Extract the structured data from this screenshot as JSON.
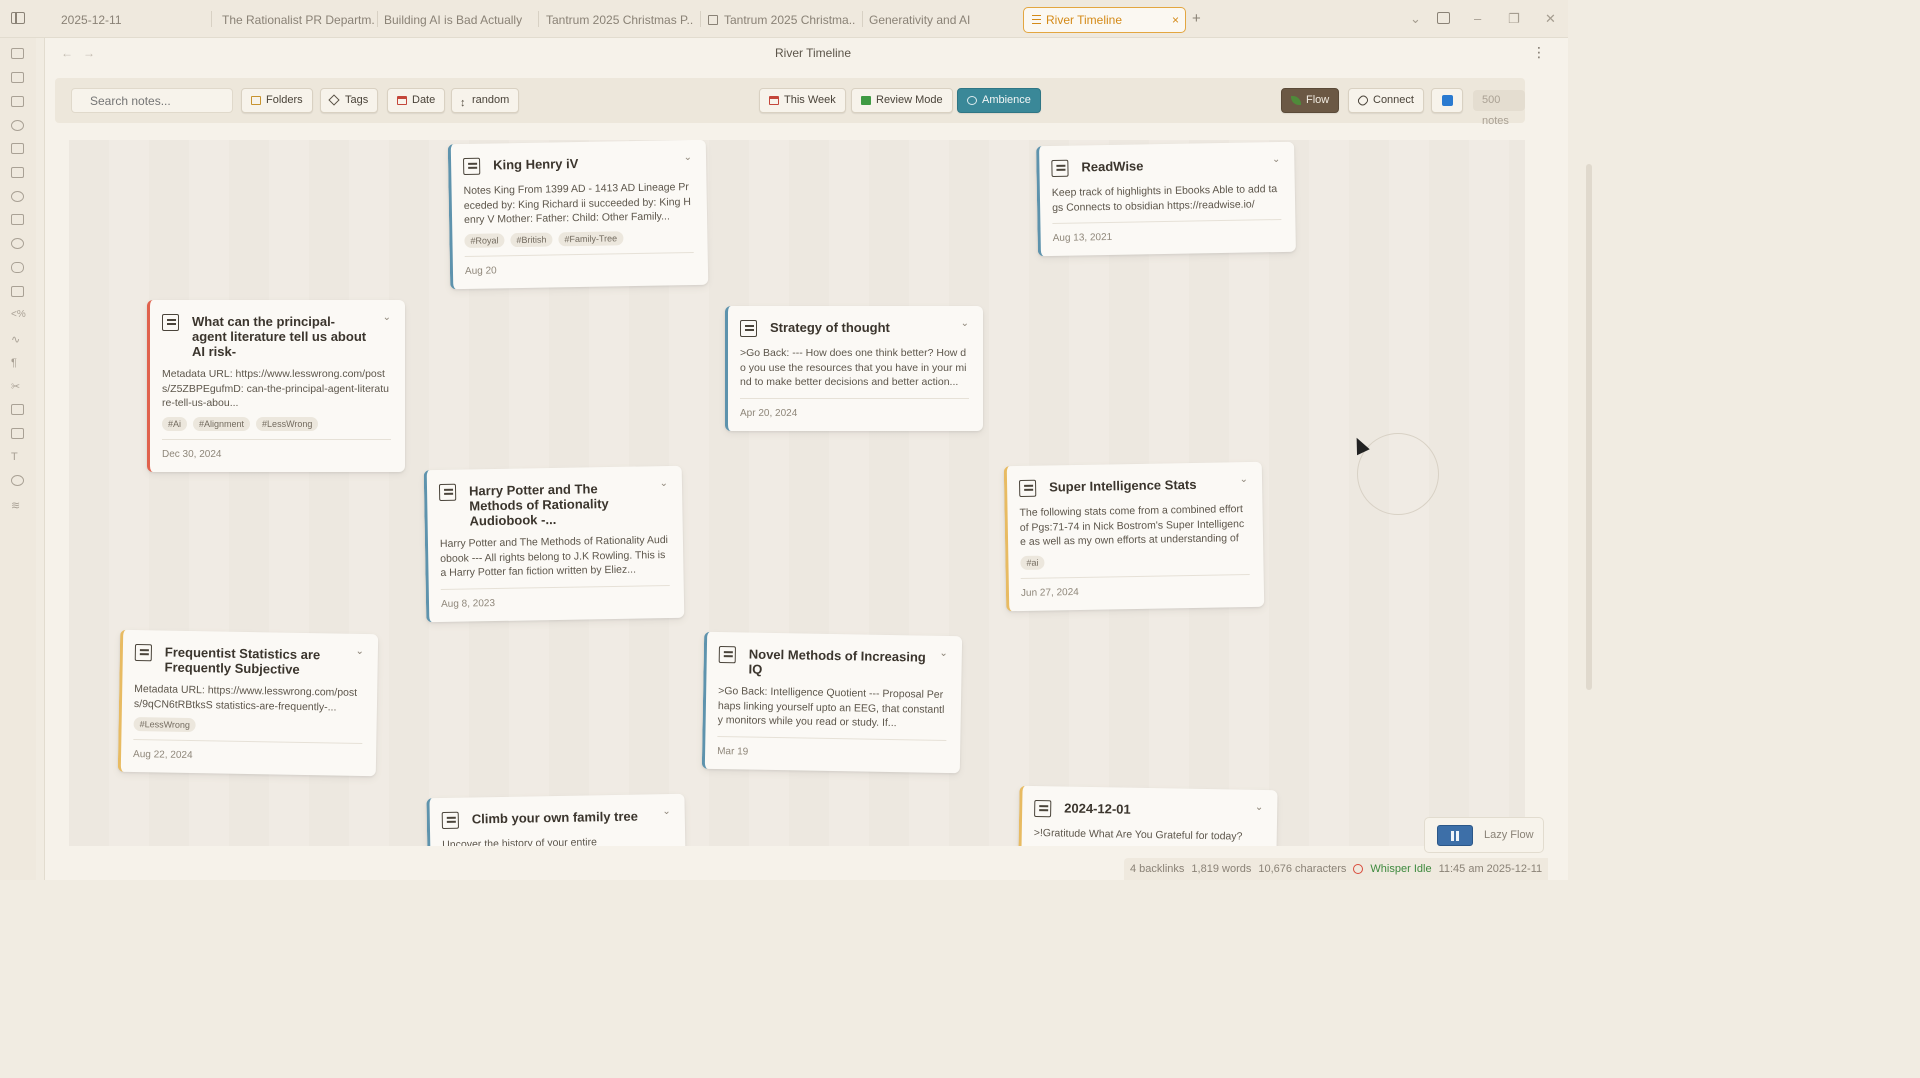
{
  "tabs": [
    {
      "label": "2025-12-11"
    },
    {
      "label": "The Rationalist PR Departm..."
    },
    {
      "label": "Building AI is Bad Actually"
    },
    {
      "label": "Tantrum 2025 Christmas P..."
    },
    {
      "label": "Tantrum 2025 Christma..."
    },
    {
      "label": "Generativity and AI"
    },
    {
      "label": "River Timeline"
    }
  ],
  "tab_close": "×",
  "tab_add": "+",
  "pane_title": "River Timeline",
  "toolbar": {
    "search_placeholder": "Search notes...",
    "folders": "Folders",
    "tags": "Tags",
    "date": "Date",
    "random": "random",
    "this_week": "This Week",
    "review_mode": "Review Mode",
    "ambience": "Ambience",
    "flow": "Flow",
    "connect": "Connect",
    "notes_count": "500 notes"
  },
  "cards": [
    {
      "title": "King Henry iV",
      "body": "Notes King From 1399 AD - 1413 AD Lineage Preceded by: King Richard ii succeeded by: King Henry V Mother: Father: Child: Other Family...",
      "tags": [
        "#Royal",
        "#British",
        "#Family-Tree"
      ],
      "date": "Aug 20"
    },
    {
      "title": "ReadWise",
      "body": "Keep track of highlights in Ebooks Able to add tags Connects to obsidian https://readwise.io/",
      "tags": [],
      "date": "Aug 13, 2021"
    },
    {
      "title": "What can the principal-agent literature tell us about AI risk-",
      "body": "Metadata URL: https://www.lesswrong.com/posts/Z5ZBPEgufmD: can-the-principal-agent-literature-tell-us-abou...",
      "tags": [
        "#Ai",
        "#Alignment",
        "#LessWrong"
      ],
      "date": "Dec 30, 2024"
    },
    {
      "title": "Strategy of thought",
      "body": ">Go Back: --- How does one think better? How do you use the resources that you have in your mind to make better decisions and better action...",
      "tags": [],
      "date": "Apr 20, 2024"
    },
    {
      "title": "Harry Potter and The Methods of Rationality Audiobook -...",
      "body": "Harry Potter and The Methods of Rationality Audiobook --- All rights belong to J.K Rowling. This is a Harry Potter fan fiction written by Eliez...",
      "tags": [],
      "date": "Aug 8, 2023"
    },
    {
      "title": "Super Intelligence Stats",
      "body": "The following stats come from a combined effort of Pgs:71-74 in Nick Bostrom's Super Intelligence as well as my own efforts at understanding of t...",
      "tags": [
        "#ai"
      ],
      "date": "Jun 27, 2024"
    },
    {
      "title": "Frequentist Statistics are Frequently Subjective",
      "body": "Metadata URL: https://www.lesswrong.com/posts/9qCN6tRBtksS statistics-are-frequently-...",
      "tags": [
        "#LessWrong"
      ],
      "date": "Aug 22, 2024"
    },
    {
      "title": "Novel Methods of Increasing IQ",
      "body": ">Go Back: Intelligence Quotient --- Proposal Perhaps linking yourself upto an EEG, that constantly monitors while you read or study. If...",
      "tags": [],
      "date": "Mar 19"
    },
    {
      "title": "Climb your own family tree",
      "body": "Uncover the history of your entire",
      "tags": [],
      "date": ""
    },
    {
      "title": "2024-12-01",
      "body": ">!Gratitude What Are You Grateful for today?",
      "tags": [],
      "date": ""
    }
  ],
  "lazy_flow": "Lazy Flow",
  "status": {
    "backlinks": "4 backlinks",
    "words": "1,819 words",
    "characters": "10,676 characters",
    "whisper": "Whisper Idle",
    "time": "11:45 am 2025-12-11"
  },
  "colors": {
    "accent_tab": "#e3a640",
    "flow_button": "#6b5844",
    "ambience_button": "#3a8898",
    "card_blue": "#5e93ad",
    "card_red": "#e0624d",
    "card_yellow": "#e8bb62"
  }
}
